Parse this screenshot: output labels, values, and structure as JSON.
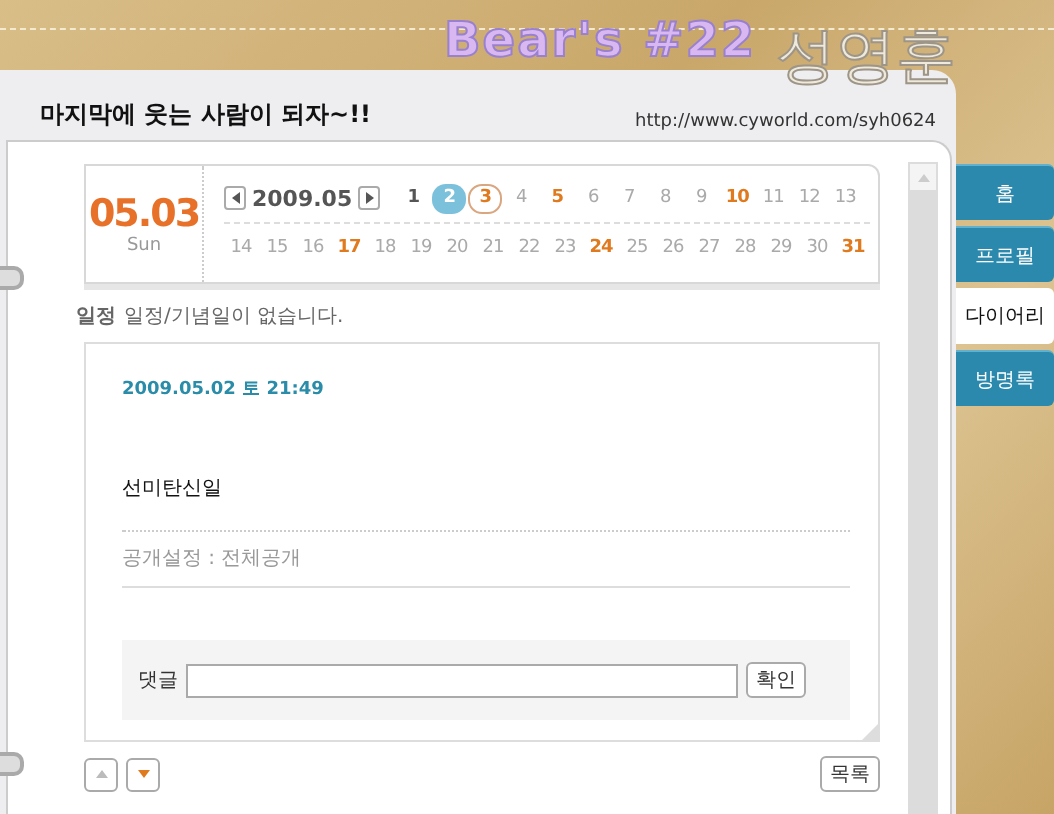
{
  "banner": {
    "title": "Bear's #22",
    "name": "성영훈"
  },
  "page": {
    "title": "마지막에 웃는 사람이 되자~!!",
    "url": "http://www.cyworld.com/syh0624"
  },
  "tabs": [
    {
      "label": "홈",
      "selected": false
    },
    {
      "label": "프로필",
      "selected": false
    },
    {
      "label": "다이어리",
      "selected": true
    },
    {
      "label": "방명록",
      "selected": false
    }
  ],
  "calendar": {
    "date": "05.03",
    "weekday": "Sun",
    "month": "2009.05",
    "days": [
      {
        "label": "1",
        "kind": "entry",
        "selected": false
      },
      {
        "label": "2",
        "kind": "entry",
        "selected": true
      },
      {
        "label": "3",
        "kind": "today",
        "selected": false
      },
      {
        "label": "4",
        "kind": "plain",
        "selected": false
      },
      {
        "label": "5",
        "kind": "holiday",
        "selected": false
      },
      {
        "label": "6",
        "kind": "plain",
        "selected": false
      },
      {
        "label": "7",
        "kind": "plain",
        "selected": false
      },
      {
        "label": "8",
        "kind": "plain",
        "selected": false
      },
      {
        "label": "9",
        "kind": "plain",
        "selected": false
      },
      {
        "label": "10",
        "kind": "holiday",
        "selected": false
      },
      {
        "label": "11",
        "kind": "plain",
        "selected": false
      },
      {
        "label": "12",
        "kind": "plain",
        "selected": false
      },
      {
        "label": "13",
        "kind": "plain",
        "selected": false
      },
      {
        "label": "14",
        "kind": "plain",
        "selected": false
      },
      {
        "label": "15",
        "kind": "plain",
        "selected": false
      },
      {
        "label": "16",
        "kind": "plain",
        "selected": false
      },
      {
        "label": "17",
        "kind": "holiday",
        "selected": false
      },
      {
        "label": "18",
        "kind": "plain",
        "selected": false
      },
      {
        "label": "19",
        "kind": "plain",
        "selected": false
      },
      {
        "label": "20",
        "kind": "plain",
        "selected": false
      },
      {
        "label": "21",
        "kind": "plain",
        "selected": false
      },
      {
        "label": "22",
        "kind": "plain",
        "selected": false
      },
      {
        "label": "23",
        "kind": "plain",
        "selected": false
      },
      {
        "label": "24",
        "kind": "holiday",
        "selected": false
      },
      {
        "label": "25",
        "kind": "plain",
        "selected": false
      },
      {
        "label": "26",
        "kind": "plain",
        "selected": false
      },
      {
        "label": "27",
        "kind": "plain",
        "selected": false
      },
      {
        "label": "28",
        "kind": "plain",
        "selected": false
      },
      {
        "label": "29",
        "kind": "plain",
        "selected": false
      },
      {
        "label": "30",
        "kind": "plain",
        "selected": false
      },
      {
        "label": "31",
        "kind": "holiday",
        "selected": false
      }
    ]
  },
  "schedule": {
    "label": "일정",
    "text": "일정/기념일이 없습니다."
  },
  "entry": {
    "datetime": "2009.05.02 토 21:49",
    "body": "선미탄신일",
    "privacy": "공개설정 : 전체공개"
  },
  "comment": {
    "label": "댓글",
    "button": "확인"
  },
  "list_button": "목록"
}
